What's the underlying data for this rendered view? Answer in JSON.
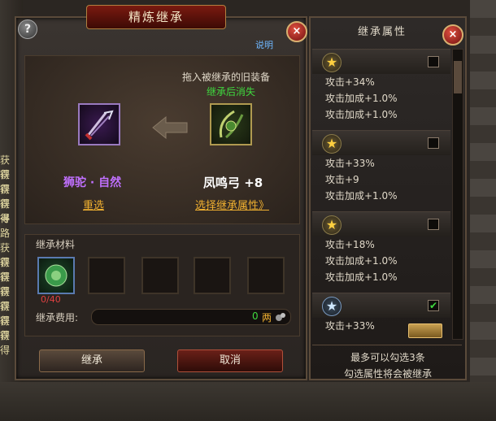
{
  "window": {
    "title": "精炼继承",
    "help_glyph": "?",
    "close_glyph": "×",
    "help_link": "说明"
  },
  "inherit": {
    "hint_line1": "拖入被继承的旧装备",
    "hint_line2": "继承后消失",
    "left_item_name": "狮驼 · 自然",
    "right_item_name": "凤鸣弓  +8",
    "reselect_label": "重选",
    "choose_attr_label": "选择继承属性》"
  },
  "materials": {
    "label": "继承材料",
    "count": "0/40",
    "cost_label": "继承费用:",
    "cost_value": "0",
    "cost_unit": "两"
  },
  "buttons": {
    "confirm": "继承",
    "cancel": "取消"
  },
  "attributes_panel": {
    "title": "继承属性",
    "close_glyph": "×",
    "groups": [
      {
        "star": "★",
        "checked": false,
        "attrs": [
          "攻击+34%",
          "攻击加成+1.0%",
          "攻击加成+1.0%"
        ]
      },
      {
        "star": "★",
        "checked": false,
        "attrs": [
          "攻击+33%",
          "攻击+9",
          "攻击加成+1.0%"
        ]
      },
      {
        "star": "★",
        "checked": false,
        "attrs": [
          "攻击+18%",
          "攻击加成+1.0%",
          "攻击加成+1.0%"
        ]
      },
      {
        "star": "★",
        "checked": true,
        "check_glyph": "✔",
        "attrs": [
          "攻击+33%"
        ]
      }
    ],
    "note_line1": "最多可以勾选3条",
    "note_line2": "勾选属性将会被继承"
  },
  "background": {
    "side_texts": [
      "获得",
      "获得",
      "获得",
      "获得",
      "寻路",
      "获得",
      "获得",
      "获得",
      "获得",
      "获得",
      "获得",
      "获得"
    ]
  },
  "colors": {
    "accent_green": "#3fd93f",
    "link_orange": "#f0b030",
    "item_purple": "#c070ff",
    "title_red": "#7a1a10"
  }
}
